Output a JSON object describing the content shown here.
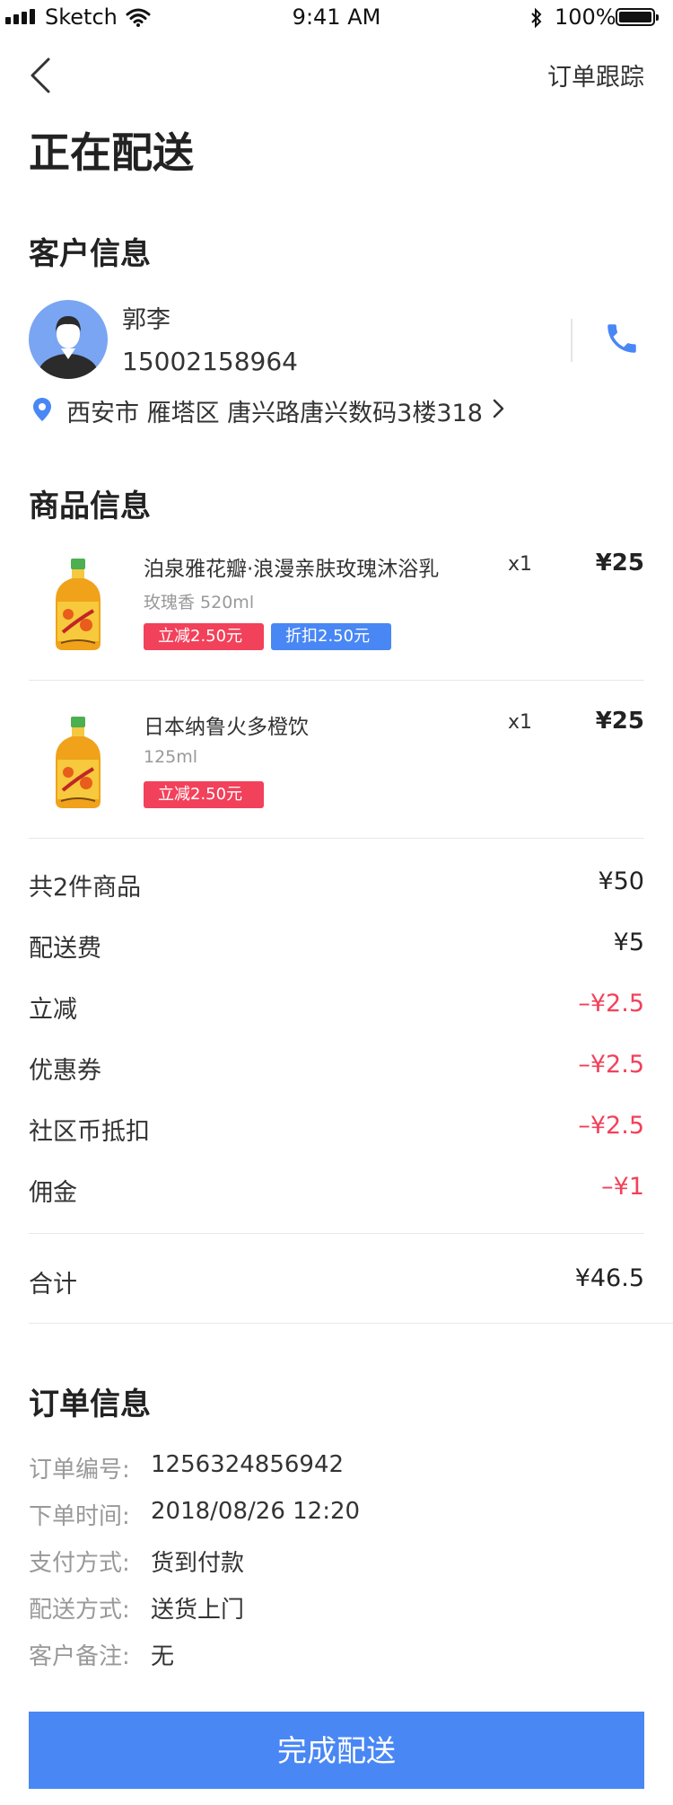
{
  "status_bar": {
    "carrier": "Sketch",
    "time": "9:41 AM",
    "battery": "100%"
  },
  "nav": {
    "track_label": "订单跟踪"
  },
  "page": {
    "title": "正在配送"
  },
  "customer": {
    "section_title": "客户信息",
    "name": "郭李",
    "phone": "15002158964",
    "address": "西安市 雁塔区 唐兴路唐兴数码3楼318"
  },
  "products": {
    "section_title": "商品信息",
    "items": [
      {
        "name": "泊泉雅花瓣·浪漫亲肤玫瑰沐浴乳",
        "qty": "x1",
        "price": "¥25",
        "spec": "玫瑰香 520ml",
        "tags": [
          "立减2.50元",
          "折扣2.50元"
        ]
      },
      {
        "name": "日本纳鲁火多橙饮",
        "qty": "x1",
        "price": "¥25",
        "spec": "125ml",
        "tags": [
          "立减2.50元"
        ]
      }
    ]
  },
  "summary": {
    "rows": [
      {
        "label": "共2件商品",
        "value": "¥50"
      },
      {
        "label": "配送费",
        "value": "¥5"
      },
      {
        "label": "立减",
        "value": "–¥2.5"
      },
      {
        "label": "优惠券",
        "value": "–¥2.5"
      },
      {
        "label": "社区币抵扣",
        "value": "–¥2.5"
      },
      {
        "label": "佣金",
        "value": "–¥1"
      }
    ],
    "total_label": "合计",
    "total_value": "¥46.5"
  },
  "order": {
    "section_title": "订单信息",
    "fields": [
      {
        "label": "订单编号:",
        "value": "1256324856942"
      },
      {
        "label": "下单时间:",
        "value": "2018/08/26 12:20"
      },
      {
        "label": "支付方式:",
        "value": "货到付款"
      },
      {
        "label": "配送方式:",
        "value": "送货上门"
      },
      {
        "label": "客户备注:",
        "value": "无"
      }
    ]
  },
  "action": {
    "complete_label": "完成配送"
  },
  "colors": {
    "accent": "#4987f5",
    "discount": "#f2415a"
  }
}
